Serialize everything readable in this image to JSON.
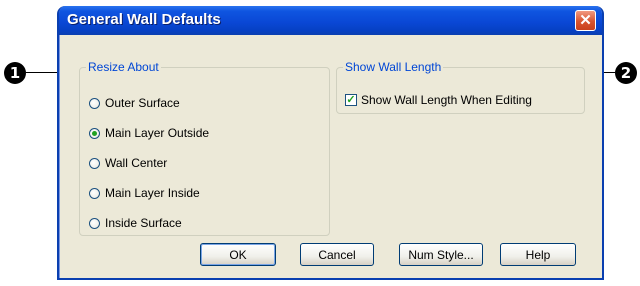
{
  "window": {
    "title": "General Wall Defaults",
    "close_glyph": "✕"
  },
  "resize_about": {
    "legend": "Resize About",
    "options": [
      {
        "label": "Outer Surface",
        "selected": false
      },
      {
        "label": "Main Layer Outside",
        "selected": true
      },
      {
        "label": "Wall Center",
        "selected": false
      },
      {
        "label": "Main Layer Inside",
        "selected": false
      },
      {
        "label": "Inside Surface",
        "selected": false
      }
    ]
  },
  "show_wall_length": {
    "legend": "Show Wall Length",
    "checkbox_label": "Show Wall Length When Editing",
    "checked": true,
    "check_glyph": "✓"
  },
  "buttons": {
    "ok": "OK",
    "cancel": "Cancel",
    "num_style": "Num Style...",
    "help": "Help"
  },
  "callouts": {
    "left": "1",
    "right": "2"
  }
}
